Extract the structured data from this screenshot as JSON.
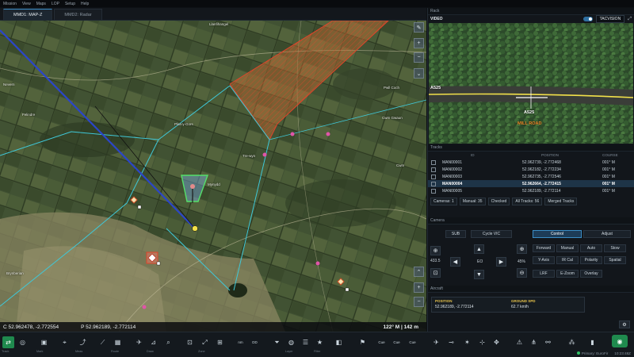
{
  "menu": [
    "Mission",
    "View",
    "Maps",
    "LOP",
    "Setup",
    "Help"
  ],
  "map_tabs": [
    {
      "label": "MMD1: MAP-Z",
      "active": true
    },
    {
      "label": "MMD2: Radar",
      "active": false
    }
  ],
  "map": {
    "place_labels": [
      "Llanfihangel",
      "Cwm",
      "Nevern",
      "Felindre",
      "Plas-y-Gors",
      "Tre-wyn",
      "Pwll Coch",
      "Cwm Gwaun",
      "Mynydd",
      "Brynberian"
    ],
    "controls": [
      "pencil-icon",
      "zoom-in-icon",
      "zoom-out-icon",
      "chevron-up-icon",
      "chevron-down-icon"
    ],
    "cursor_coord": "C 52.962478, -2.772554",
    "pointer_coord": "P 52.962189, -2.772114",
    "heading_alt": "122° M | 142 m"
  },
  "rack": {
    "title": "Rack",
    "video_label": "VIDEO",
    "source": "TACVISION",
    "overlays": {
      "road_left": "A525",
      "road_center": "A525",
      "road_name": "MILL ROAD"
    }
  },
  "tracks": {
    "title": "Tracks",
    "columns": [
      "ID",
      "POSITION",
      "COURSE"
    ],
    "rows": [
      {
        "id": "MAN00001",
        "pos": "52.962739, -2.772468",
        "course": "001° M",
        "selected": false
      },
      {
        "id": "MAN00002",
        "pos": "52.962182, -2.772234",
        "course": "001° M",
        "selected": false
      },
      {
        "id": "MAN00003",
        "pos": "52.962735, -2.772546",
        "course": "001° M",
        "selected": false
      },
      {
        "id": "MAN00004",
        "pos": "52.962664, -2.772415",
        "course": "001° M",
        "selected": true
      },
      {
        "id": "MAN00005",
        "pos": "52.962189, -2.772114",
        "course": "001° M",
        "selected": false
      }
    ],
    "filters": [
      "Cameras: 1",
      "Manual: 35",
      "Checked",
      "All Tracks: 56",
      "Merged Tracks"
    ]
  },
  "camera": {
    "title": "Camera",
    "buttons": {
      "sub": "SUB",
      "cycle": "Cycle VIC",
      "control": "Control",
      "adjust": "Adjust"
    },
    "zoom_left": "433.5",
    "eo": "EO",
    "zoom_pct": "45%",
    "modes": [
      "Forward",
      "Manual",
      "Auto",
      "Stow",
      "Y-Axis",
      "IR Cal",
      "Polarity",
      "Spatial",
      "LRF",
      "E-Zoom",
      "Overlay"
    ]
  },
  "aircraft": {
    "title": "Aircraft",
    "position_label": "POSITION",
    "position_value": "52.962189, -2.772114",
    "speed_label": "GROUND SPD",
    "speed_value": "62.7 km/h"
  },
  "toolbar": {
    "text_buttons": [
      "nm",
      "DD",
      "Cue",
      "Cue",
      "Cue"
    ],
    "labels": [
      "Track",
      "Mark",
      "Meas",
      "Route",
      "Draw",
      "Zone",
      "Layer",
      "Filter"
    ],
    "status": "Primary: EuroFir",
    "time": "10:23:48Z"
  },
  "colors": {
    "accent": "#3a8cc4",
    "green": "#1f8a4e",
    "zone_red": "#e0442a",
    "route_cyan": "#3fc8d8",
    "route_blue": "#2b46c8"
  }
}
